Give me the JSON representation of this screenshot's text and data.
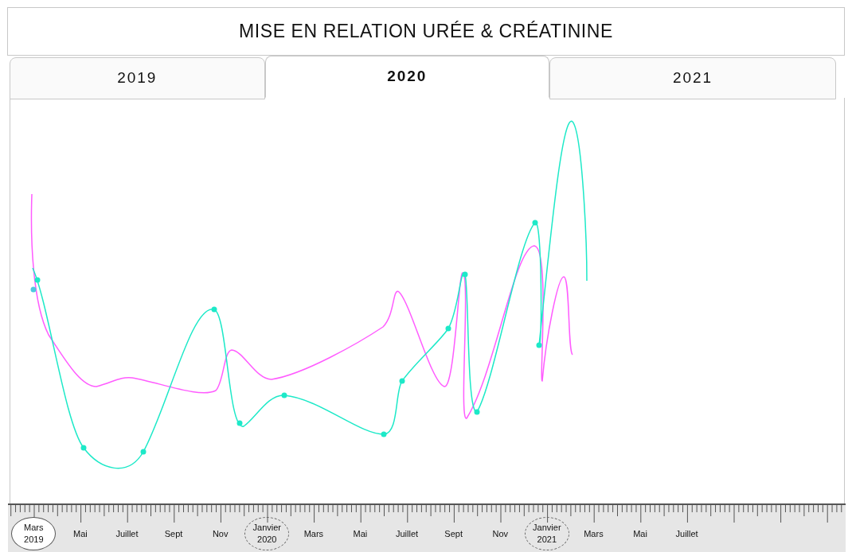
{
  "title": "MISE EN RELATION URÉE & CRÉATININE",
  "tabs": [
    {
      "label": "2019",
      "selected": false
    },
    {
      "label": "2020",
      "selected": true
    },
    {
      "label": "2021",
      "selected": false
    }
  ],
  "timeline": [
    {
      "text": "Mars",
      "year": "2019",
      "kind": "solid"
    },
    {
      "text": "Mai",
      "kind": "plain"
    },
    {
      "text": "Juillet",
      "kind": "plain"
    },
    {
      "text": "Sept",
      "kind": "plain"
    },
    {
      "text": "Nov",
      "kind": "plain"
    },
    {
      "text": "Janvier",
      "year": "2020",
      "kind": "dashed"
    },
    {
      "text": "Mars",
      "kind": "plain"
    },
    {
      "text": "Mai",
      "kind": "plain"
    },
    {
      "text": "Juillet",
      "kind": "plain"
    },
    {
      "text": "Sept",
      "kind": "plain"
    },
    {
      "text": "Nov",
      "kind": "plain"
    },
    {
      "text": "Janvier",
      "year": "2021",
      "kind": "dashed"
    },
    {
      "text": "Mars",
      "kind": "plain"
    },
    {
      "text": "Mai",
      "kind": "plain"
    },
    {
      "text": "Juillet",
      "kind": "plain"
    }
  ]
}
